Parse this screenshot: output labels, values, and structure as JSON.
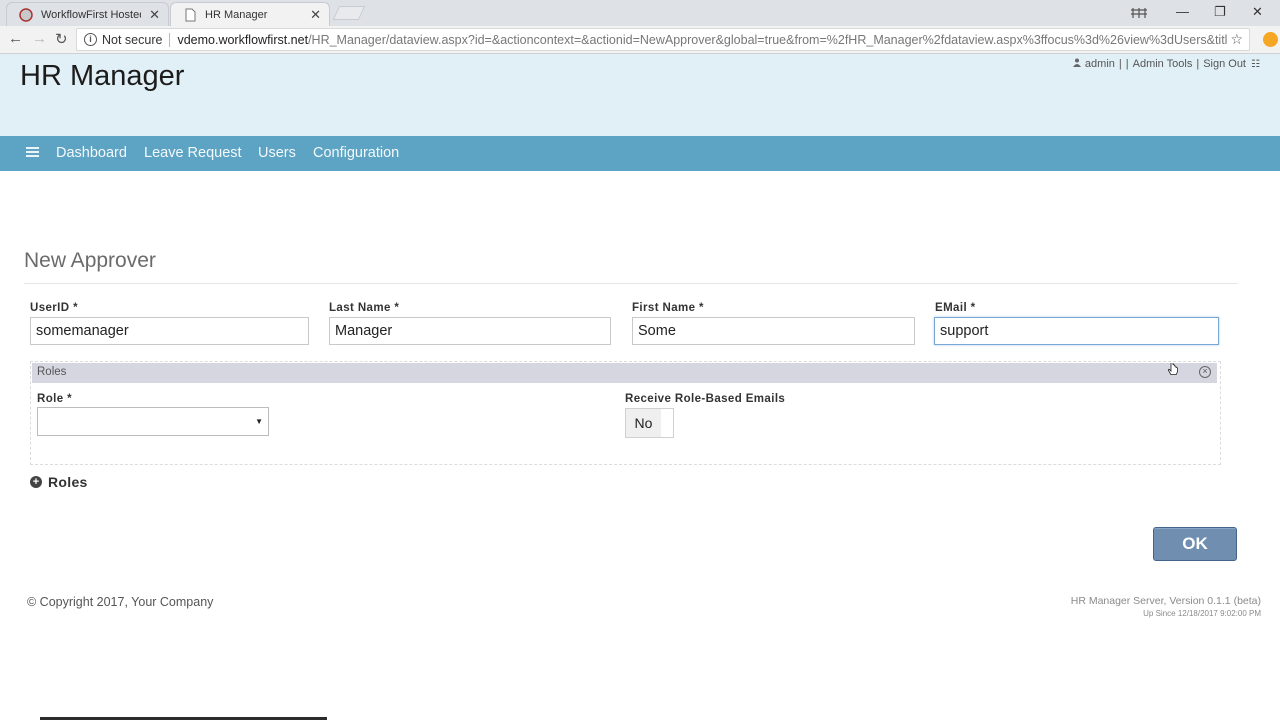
{
  "browser": {
    "tabs": [
      {
        "label": "WorkflowFirst Hosted De",
        "active": false
      },
      {
        "label": "HR Manager",
        "active": true
      }
    ],
    "security_label": "Not secure",
    "url_host": "vdemo.workflowfirst.net",
    "url_path": "/HR_Manager/dataview.aspx?id=&actioncontext=&actionid=NewApprover&global=true&from=%2fHR_Manager%2fdataview.aspx%3ffocus%3d%26view%3dUsers&title=New+A..."
  },
  "header": {
    "app_title": "HR Manager",
    "user": "admin",
    "links": {
      "admin_tools": "Admin Tools",
      "sign_out": "Sign Out"
    },
    "separator": "|"
  },
  "nav": {
    "items": [
      {
        "label": "Dashboard"
      },
      {
        "label": "Leave Request"
      },
      {
        "label": "Users"
      },
      {
        "label": "Configuration"
      }
    ]
  },
  "form": {
    "title": "New Approver",
    "fields": {
      "userid": {
        "label": "UserID *",
        "value": "somemanager"
      },
      "last_name": {
        "label": "Last Name *",
        "value": "Manager"
      },
      "first_name": {
        "label": "First Name *",
        "value": "Some"
      },
      "email": {
        "label": "EMail *",
        "value": "support"
      }
    },
    "roles_section": {
      "header": "Roles",
      "role_label": "Role *",
      "role_value": "",
      "emails_label": "Receive Role-Based Emails",
      "emails_value": "No"
    },
    "roles_expander_label": "Roles",
    "ok_label": "OK"
  },
  "footer": {
    "copyright": "© Copyright 2017, Your Company",
    "version": "HR Manager Server, Version 0.1.1 (beta)",
    "uptime": "Up Since 12/18/2017 9:02:00 PM"
  },
  "colors": {
    "header_bg": "#e1f0f6",
    "nav_bg": "#5da3c3",
    "ok_button": "#6f8eb0",
    "roles_header_bg": "#d6d6e0"
  }
}
